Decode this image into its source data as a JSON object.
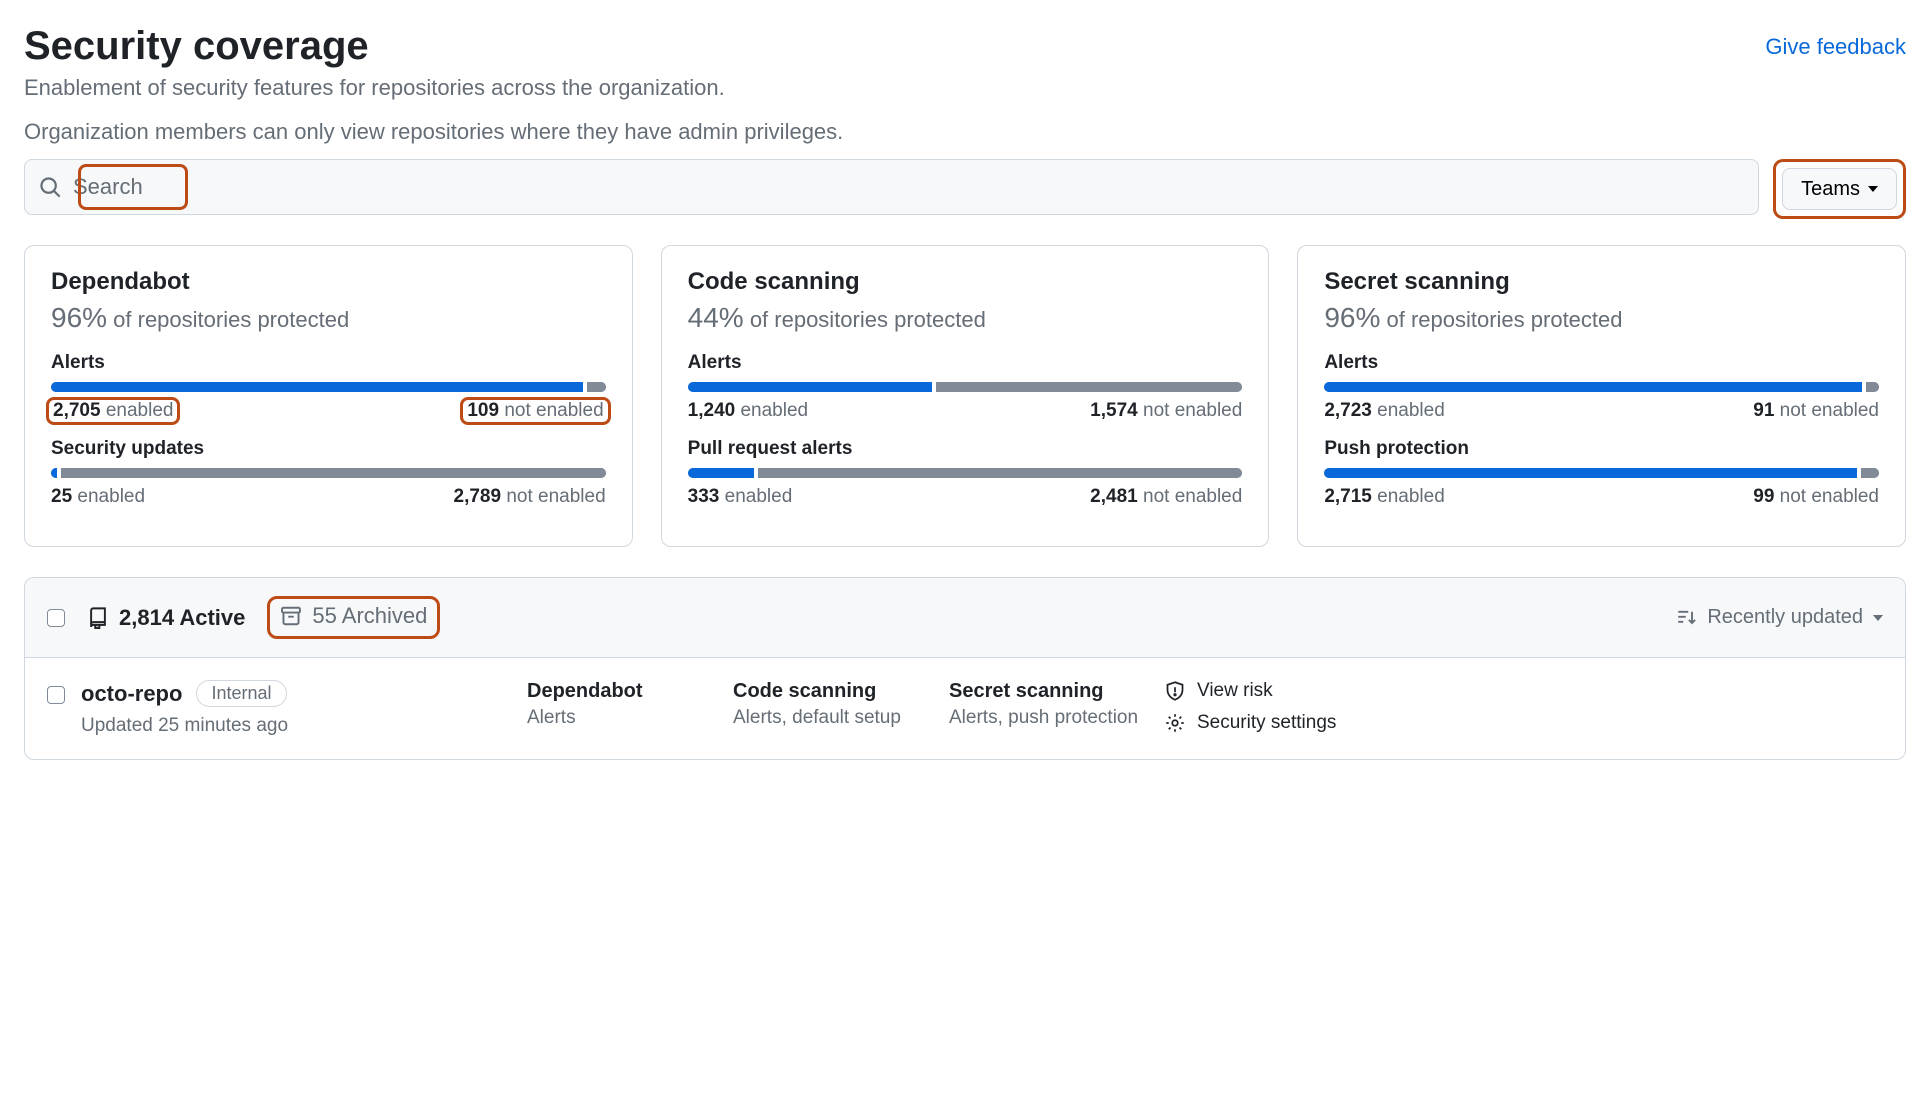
{
  "header": {
    "title": "Security coverage",
    "feedback": "Give feedback",
    "subhead": "Enablement of security features for repositories across the organization.",
    "note": "Organization members can only view repositories where they have admin privileges."
  },
  "search": {
    "placeholder": "Search",
    "teams_label": "Teams"
  },
  "cards": [
    {
      "title": "Dependabot",
      "pct": "96%",
      "pct_suffix": "of repositories protected",
      "metrics": [
        {
          "label": "Alerts",
          "enabled_n": "2,705",
          "enabled_lbl": "enabled",
          "disabled_n": "109",
          "disabled_lbl": "not enabled",
          "pct_on": 96,
          "highlight": true
        },
        {
          "label": "Security updates",
          "enabled_n": "25",
          "enabled_lbl": "enabled",
          "disabled_n": "2,789",
          "disabled_lbl": "not enabled",
          "pct_on": 1,
          "highlight": false
        }
      ]
    },
    {
      "title": "Code scanning",
      "pct": "44%",
      "pct_suffix": "of repositories protected",
      "metrics": [
        {
          "label": "Alerts",
          "enabled_n": "1,240",
          "enabled_lbl": "enabled",
          "disabled_n": "1,574",
          "disabled_lbl": "not enabled",
          "pct_on": 44,
          "highlight": false
        },
        {
          "label": "Pull request alerts",
          "enabled_n": "333",
          "enabled_lbl": "enabled",
          "disabled_n": "2,481",
          "disabled_lbl": "not enabled",
          "pct_on": 12,
          "highlight": false
        }
      ]
    },
    {
      "title": "Secret scanning",
      "pct": "96%",
      "pct_suffix": "of repositories protected",
      "metrics": [
        {
          "label": "Alerts",
          "enabled_n": "2,723",
          "enabled_lbl": "enabled",
          "disabled_n": "91",
          "disabled_lbl": "not enabled",
          "pct_on": 97,
          "highlight": false
        },
        {
          "label": "Push protection",
          "enabled_n": "2,715",
          "enabled_lbl": "enabled",
          "disabled_n": "99",
          "disabled_lbl": "not enabled",
          "pct_on": 96,
          "highlight": false
        }
      ]
    }
  ],
  "table": {
    "active_count": "2,814",
    "active_label": "Active",
    "archived_count": "55",
    "archived_label": "Archived",
    "sort_label": "Recently updated"
  },
  "row": {
    "name": "octo-repo",
    "visibility": "Internal",
    "updated": "Updated 25 minutes ago",
    "dependabot_h": "Dependabot",
    "dependabot_v": "Alerts",
    "code_h": "Code scanning",
    "code_v": "Alerts, default setup",
    "secret_h": "Secret scanning",
    "secret_v": "Alerts, push protection",
    "view_risk": "View risk",
    "security_settings": "Security settings"
  },
  "chart_data": [
    {
      "type": "bar",
      "title": "Dependabot Alerts",
      "categories": [
        "enabled",
        "not enabled"
      ],
      "values": [
        2705,
        109
      ]
    },
    {
      "type": "bar",
      "title": "Dependabot Security updates",
      "categories": [
        "enabled",
        "not enabled"
      ],
      "values": [
        25,
        2789
      ]
    },
    {
      "type": "bar",
      "title": "Code scanning Alerts",
      "categories": [
        "enabled",
        "not enabled"
      ],
      "values": [
        1240,
        1574
      ]
    },
    {
      "type": "bar",
      "title": "Code scanning Pull request alerts",
      "categories": [
        "enabled",
        "not enabled"
      ],
      "values": [
        333,
        2481
      ]
    },
    {
      "type": "bar",
      "title": "Secret scanning Alerts",
      "categories": [
        "enabled",
        "not enabled"
      ],
      "values": [
        2723,
        91
      ]
    },
    {
      "type": "bar",
      "title": "Secret scanning Push protection",
      "categories": [
        "enabled",
        "not enabled"
      ],
      "values": [
        2715,
        99
      ]
    }
  ]
}
